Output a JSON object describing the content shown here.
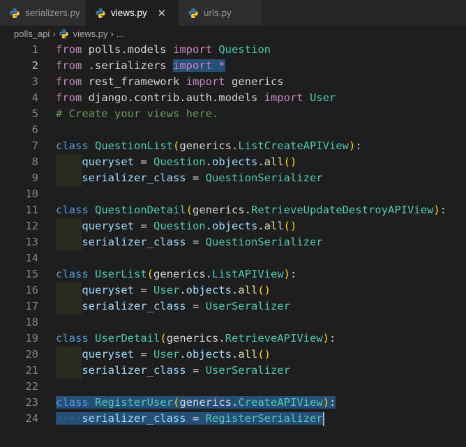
{
  "tabs": [
    {
      "label": "serializers.py",
      "active": false
    },
    {
      "label": "views.py",
      "active": true,
      "close": "✕"
    },
    {
      "label": "urls.py",
      "active": false
    }
  ],
  "breadcrumb": {
    "folder": "polls_api",
    "file": "views.py",
    "more": "..."
  },
  "code": {
    "line_numbers": [
      "1",
      "2",
      "3",
      "4",
      "5",
      "6",
      "7",
      "8",
      "9",
      "10",
      "11",
      "12",
      "13",
      "14",
      "15",
      "16",
      "17",
      "18",
      "19",
      "20",
      "21",
      "22",
      "23",
      "24"
    ],
    "current_line": 2,
    "lines": [
      [
        {
          "t": "from",
          "c": "kwc"
        },
        {
          "t": " polls.models ",
          "c": "op"
        },
        {
          "t": "import",
          "c": "kwc"
        },
        {
          "t": " ",
          "c": "op"
        },
        {
          "t": "Question",
          "c": "cls"
        }
      ],
      [
        {
          "t": "from",
          "c": "kwc"
        },
        {
          "t": " .serializers ",
          "c": "op"
        },
        {
          "t": "import *",
          "c": "kwc",
          "sel": true
        }
      ],
      [
        {
          "t": "from",
          "c": "kwc"
        },
        {
          "t": " rest_framework ",
          "c": "op"
        },
        {
          "t": "import",
          "c": "kwc"
        },
        {
          "t": " generics",
          "c": "op"
        }
      ],
      [
        {
          "t": "from",
          "c": "kwc"
        },
        {
          "t": " django.contrib.auth.models ",
          "c": "op"
        },
        {
          "t": "import",
          "c": "kwc"
        },
        {
          "t": " ",
          "c": "op"
        },
        {
          "t": "User",
          "c": "cls"
        }
      ],
      [
        {
          "t": "# Create your views here.",
          "c": "cm"
        }
      ],
      [],
      [
        {
          "t": "class",
          "c": "kw"
        },
        {
          "t": " ",
          "c": "op"
        },
        {
          "t": "QuestionList",
          "c": "cls"
        },
        {
          "t": "(",
          "c": "b1"
        },
        {
          "t": "generics",
          "c": "op"
        },
        {
          "t": ".",
          "c": "op"
        },
        {
          "t": "ListCreateAPIView",
          "c": "cls"
        },
        {
          "t": ")",
          "c": "b1"
        },
        {
          "t": ":",
          "c": "op"
        }
      ],
      [
        {
          "t": "    ",
          "c": "op",
          "indent": true
        },
        {
          "t": "queryset",
          "c": "var"
        },
        {
          "t": " = ",
          "c": "op"
        },
        {
          "t": "Question",
          "c": "cls"
        },
        {
          "t": ".",
          "c": "op"
        },
        {
          "t": "objects",
          "c": "var"
        },
        {
          "t": ".",
          "c": "op"
        },
        {
          "t": "all",
          "c": "fn"
        },
        {
          "t": "()",
          "c": "b1"
        }
      ],
      [
        {
          "t": "    ",
          "c": "op",
          "indent": true
        },
        {
          "t": "serializer_class",
          "c": "var"
        },
        {
          "t": " = ",
          "c": "op"
        },
        {
          "t": "QuestionSerializer",
          "c": "cls"
        }
      ],
      [],
      [
        {
          "t": "class",
          "c": "kw"
        },
        {
          "t": " ",
          "c": "op"
        },
        {
          "t": "QuestionDetail",
          "c": "cls"
        },
        {
          "t": "(",
          "c": "b1"
        },
        {
          "t": "generics",
          "c": "op"
        },
        {
          "t": ".",
          "c": "op"
        },
        {
          "t": "RetrieveUpdateDestroyAPIView",
          "c": "cls"
        },
        {
          "t": ")",
          "c": "b1"
        },
        {
          "t": ":",
          "c": "op"
        }
      ],
      [
        {
          "t": "    ",
          "c": "op",
          "indent": true
        },
        {
          "t": "queryset",
          "c": "var"
        },
        {
          "t": " = ",
          "c": "op"
        },
        {
          "t": "Question",
          "c": "cls"
        },
        {
          "t": ".",
          "c": "op"
        },
        {
          "t": "objects",
          "c": "var"
        },
        {
          "t": ".",
          "c": "op"
        },
        {
          "t": "all",
          "c": "fn"
        },
        {
          "t": "()",
          "c": "b1"
        }
      ],
      [
        {
          "t": "    ",
          "c": "op",
          "indent": true
        },
        {
          "t": "serializer_class",
          "c": "var"
        },
        {
          "t": " = ",
          "c": "op"
        },
        {
          "t": "QuestionSerializer",
          "c": "cls"
        }
      ],
      [],
      [
        {
          "t": "class",
          "c": "kw"
        },
        {
          "t": " ",
          "c": "op"
        },
        {
          "t": "UserList",
          "c": "cls"
        },
        {
          "t": "(",
          "c": "b1"
        },
        {
          "t": "generics",
          "c": "op"
        },
        {
          "t": ".",
          "c": "op"
        },
        {
          "t": "ListAPIView",
          "c": "cls"
        },
        {
          "t": ")",
          "c": "b1"
        },
        {
          "t": ":",
          "c": "op"
        }
      ],
      [
        {
          "t": "    ",
          "c": "op",
          "indent": true
        },
        {
          "t": "queryset",
          "c": "var"
        },
        {
          "t": " = ",
          "c": "op"
        },
        {
          "t": "User",
          "c": "cls"
        },
        {
          "t": ".",
          "c": "op"
        },
        {
          "t": "objects",
          "c": "var"
        },
        {
          "t": ".",
          "c": "op"
        },
        {
          "t": "all",
          "c": "fn"
        },
        {
          "t": "()",
          "c": "b1"
        }
      ],
      [
        {
          "t": "    ",
          "c": "op",
          "indent": true
        },
        {
          "t": "serializer_class",
          "c": "var"
        },
        {
          "t": " = ",
          "c": "op"
        },
        {
          "t": "UserSeralizer",
          "c": "cls"
        }
      ],
      [],
      [
        {
          "t": "class",
          "c": "kw"
        },
        {
          "t": " ",
          "c": "op"
        },
        {
          "t": "UserDetail",
          "c": "cls"
        },
        {
          "t": "(",
          "c": "b1"
        },
        {
          "t": "generics",
          "c": "op"
        },
        {
          "t": ".",
          "c": "op"
        },
        {
          "t": "RetrieveAPIView",
          "c": "cls"
        },
        {
          "t": ")",
          "c": "b1"
        },
        {
          "t": ":",
          "c": "op"
        }
      ],
      [
        {
          "t": "    ",
          "c": "op",
          "indent": true
        },
        {
          "t": "queryset",
          "c": "var"
        },
        {
          "t": " = ",
          "c": "op"
        },
        {
          "t": "User",
          "c": "cls"
        },
        {
          "t": ".",
          "c": "op"
        },
        {
          "t": "objects",
          "c": "var"
        },
        {
          "t": ".",
          "c": "op"
        },
        {
          "t": "all",
          "c": "fn"
        },
        {
          "t": "()",
          "c": "b1"
        }
      ],
      [
        {
          "t": "    ",
          "c": "op",
          "indent": true
        },
        {
          "t": "serializer_class",
          "c": "var"
        },
        {
          "t": " = ",
          "c": "op"
        },
        {
          "t": "UserSeralizer",
          "c": "cls"
        }
      ],
      [],
      [
        {
          "t": "class",
          "c": "kw",
          "sel": true
        },
        {
          "t": " ",
          "c": "op",
          "sel": true
        },
        {
          "t": "RegisterUser",
          "c": "cls",
          "sel": true
        },
        {
          "t": "(",
          "c": "b1",
          "sel": true
        },
        {
          "t": "generics",
          "c": "op",
          "sel": true
        },
        {
          "t": ".",
          "c": "op",
          "sel": true
        },
        {
          "t": "CreateAPIView",
          "c": "cls",
          "sel": true
        },
        {
          "t": ")",
          "c": "b1",
          "sel": true
        },
        {
          "t": ":",
          "c": "op",
          "sel": true
        }
      ],
      [
        {
          "t": "····",
          "c": "ws",
          "sel": true
        },
        {
          "t": "serializer_class",
          "c": "var",
          "sel": true
        },
        {
          "t": " = ",
          "c": "op",
          "sel": true
        },
        {
          "t": "RegisterSerializer",
          "c": "cls",
          "sel": true
        },
        {
          "t": "",
          "c": "cursor"
        }
      ]
    ]
  }
}
